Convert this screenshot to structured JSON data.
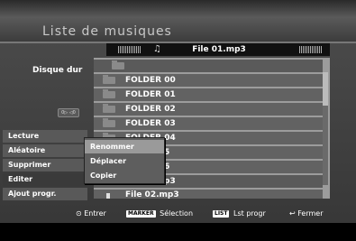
{
  "header": {
    "title": "Liste de musiques"
  },
  "device": {
    "label": "Disque dur",
    "indicator": "0▷ ◁0"
  },
  "current_file": {
    "name": "File 01.mp3",
    "icon": "music-note-icon"
  },
  "list": {
    "items": [
      {
        "label": "",
        "type": "parent-folder"
      },
      {
        "label": "FOLDER 00",
        "type": "folder"
      },
      {
        "label": "FOLDER 01",
        "type": "folder"
      },
      {
        "label": "FOLDER 02",
        "type": "folder"
      },
      {
        "label": "FOLDER 03",
        "type": "folder"
      },
      {
        "label": "FOLDER 04",
        "type": "folder"
      },
      {
        "label": "5",
        "type": "folder"
      },
      {
        "label": "6",
        "type": "folder"
      },
      {
        "label": "p3",
        "type": "file"
      },
      {
        "label": "File 02.mp3",
        "type": "file"
      }
    ]
  },
  "side_menu": {
    "items": [
      {
        "label": "Lecture"
      },
      {
        "label": "Aléatoire"
      },
      {
        "label": "Supprimer"
      },
      {
        "label": "Editer"
      },
      {
        "label": "Ajout progr."
      }
    ],
    "active_index": 3
  },
  "popup": {
    "items": [
      {
        "label": "Renommer"
      },
      {
        "label": "Déplacer"
      },
      {
        "label": "Copier"
      }
    ],
    "selected_index": 0
  },
  "footer": {
    "enter_icon": "⊙",
    "enter_label": "Entrer",
    "marker_key": "MARKER",
    "marker_label": "Sélection",
    "list_key": "LIST",
    "list_label": "Lst progr",
    "close_icon": "↩",
    "close_label": "Fermer"
  }
}
